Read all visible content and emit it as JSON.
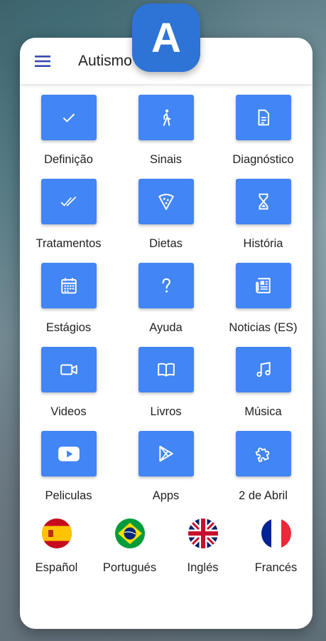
{
  "app": {
    "title": "Autismo",
    "badge_letter": "A"
  },
  "colors": {
    "accent": "#4285f4",
    "badge": "#2e73d6"
  },
  "tiles": [
    {
      "label": "Definição",
      "icon": "check-icon"
    },
    {
      "label": "Sinais",
      "icon": "walking-person-icon"
    },
    {
      "label": "Diagnóstico",
      "icon": "document-icon"
    },
    {
      "label": "Tratamentos",
      "icon": "double-check-icon"
    },
    {
      "label": "Dietas",
      "icon": "pizza-icon"
    },
    {
      "label": "História",
      "icon": "hourglass-icon"
    },
    {
      "label": "Estágios",
      "icon": "calendar-icon"
    },
    {
      "label": "Ayuda",
      "icon": "question-icon"
    },
    {
      "label": "Noticias (ES)",
      "icon": "newspaper-icon"
    },
    {
      "label": "Videos",
      "icon": "video-camera-icon"
    },
    {
      "label": "Livros",
      "icon": "book-icon"
    },
    {
      "label": "Música",
      "icon": "music-note-icon"
    },
    {
      "label": "Peliculas",
      "icon": "youtube-icon"
    },
    {
      "label": "Apps",
      "icon": "play-store-icon"
    },
    {
      "label": "2 de Abril",
      "icon": "puzzle-icon"
    }
  ],
  "languages": [
    {
      "label": "Español",
      "icon": "spain-flag-icon"
    },
    {
      "label": "Portugués",
      "icon": "brazil-flag-icon"
    },
    {
      "label": "Inglés",
      "icon": "uk-flag-icon"
    },
    {
      "label": "Francés",
      "icon": "france-flag-icon"
    }
  ]
}
